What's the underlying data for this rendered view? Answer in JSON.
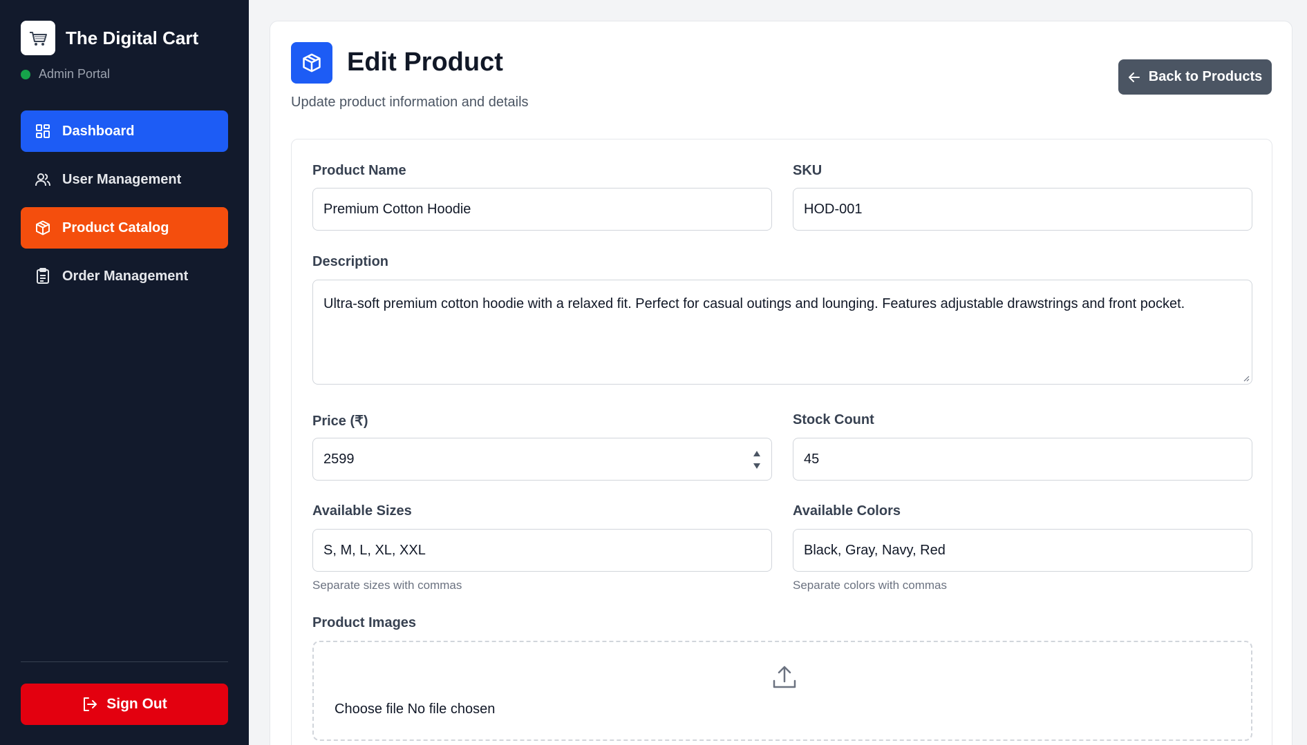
{
  "brand": {
    "title": "The Digital Cart",
    "subtitle": "Admin Portal",
    "status_color": "#16a34a"
  },
  "sidebar": {
    "items": [
      {
        "label": "Dashboard",
        "icon": "dashboard-grid-icon",
        "state": "highlighted",
        "color": "#1d5cf5"
      },
      {
        "label": "User Management",
        "icon": "users-icon",
        "state": "default"
      },
      {
        "label": "Product Catalog",
        "icon": "package-icon",
        "state": "active",
        "color": "#f44e0d"
      },
      {
        "label": "Order Management",
        "icon": "clipboard-icon",
        "state": "default"
      }
    ],
    "signout_label": "Sign Out",
    "signout_icon": "sign-out-icon",
    "signout_color": "#e3000f"
  },
  "header": {
    "title": "Edit Product",
    "subtitle": "Update product information and details",
    "icon": "package-icon",
    "back_label": "Back to Products",
    "back_icon": "arrow-left-icon"
  },
  "form": {
    "product_name": {
      "label": "Product Name",
      "value": "Premium Cotton Hoodie"
    },
    "sku": {
      "label": "SKU",
      "value": "HOD-001"
    },
    "description": {
      "label": "Description",
      "value": "Ultra-soft premium cotton hoodie with a relaxed fit. Perfect for casual outings and lounging. Features adjustable drawstrings and front pocket."
    },
    "price": {
      "label": "Price (₹)",
      "value": "2599"
    },
    "stock": {
      "label": "Stock Count",
      "value": "45"
    },
    "sizes": {
      "label": "Available Sizes",
      "value": "S, M, L, XL, XXL",
      "hint": "Separate sizes with commas"
    },
    "colors": {
      "label": "Available Colors",
      "value": "Black, Gray, Navy, Red",
      "hint": "Separate colors with commas"
    },
    "images": {
      "label": "Product Images",
      "file_text": "Choose file No file chosen",
      "icon": "upload-icon"
    }
  }
}
